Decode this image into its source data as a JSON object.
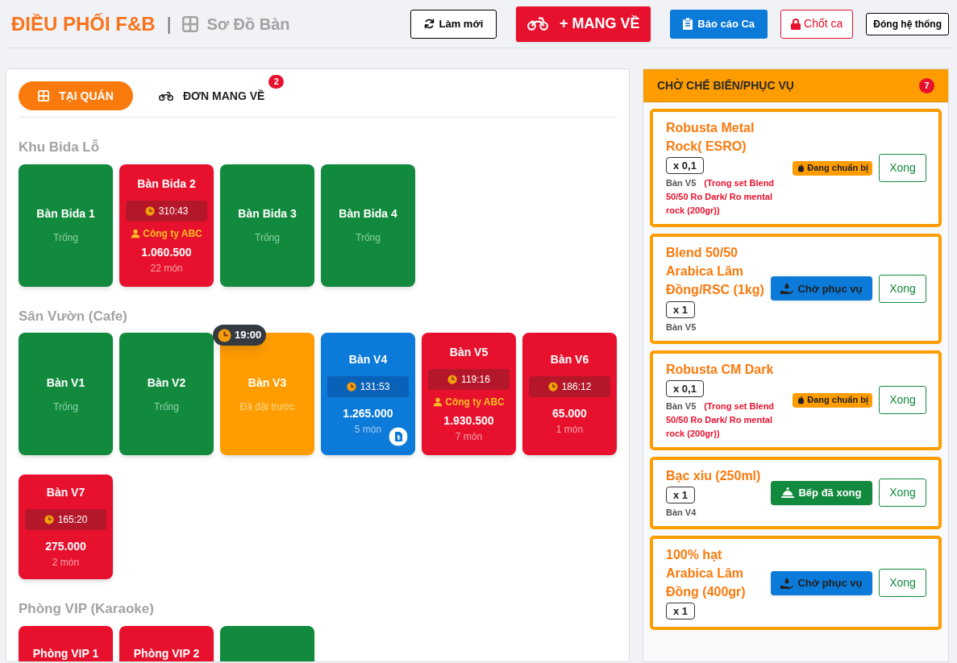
{
  "header": {
    "title": "ĐIỀU PHỐI F&B",
    "separator": "|",
    "subtitle": "Sơ Đồ Bàn",
    "buttons": [
      {
        "kind": "refresh",
        "label": "Làm mới"
      },
      {
        "kind": "takeaway",
        "label": "+ MANG VỀ"
      },
      {
        "kind": "report",
        "label": "Báo cáo Ca"
      },
      {
        "kind": "close_shift",
        "label": "Chốt ca"
      },
      {
        "kind": "shutdown",
        "label": "Đóng hệ thống"
      }
    ]
  },
  "tabs": [
    {
      "label": "TẠI QUÁN",
      "selected": true
    },
    {
      "label": "ĐƠN MANG VỀ",
      "selected": false,
      "badge": "2"
    }
  ],
  "areas": [
    {
      "title": "Khu Bida Lỗ",
      "tables": [
        {
          "name": "Bàn Bida 1",
          "kind": "empty",
          "status_text": "Trống"
        },
        {
          "name": "Bàn Bida 2",
          "kind": "occupied",
          "timer": "310:43",
          "customer": "Công ty ABC",
          "total": "1.060.500",
          "items": "22 món"
        },
        {
          "name": "Bàn Bida 3",
          "kind": "empty",
          "status_text": "Trống"
        },
        {
          "name": "Bàn Bida 4",
          "kind": "empty",
          "status_text": "Trống"
        }
      ]
    },
    {
      "title": "Sân Vườn (Cafe)",
      "tables": [
        {
          "name": "Bàn V1",
          "kind": "empty",
          "status_text": "Trống"
        },
        {
          "name": "Bàn V2",
          "kind": "empty",
          "status_text": "Trống"
        },
        {
          "name": "Bàn V3",
          "kind": "reserved",
          "status_text": "Đã đặt trước",
          "reservation_time": "19:00"
        },
        {
          "name": "Bàn V4",
          "kind": "billing",
          "timer": "131:53",
          "total": "1.265.000",
          "items": "5 món",
          "bill_icon": true
        },
        {
          "name": "Bàn V5",
          "kind": "occupied",
          "timer": "119:16",
          "customer": "Công ty ABC",
          "total": "1.930.500",
          "items": "7 món"
        },
        {
          "name": "Bàn V6",
          "kind": "occupied",
          "timer": "186:12",
          "total": "65.000",
          "items": "1 món"
        },
        {
          "name": "Bàn V7",
          "kind": "occupied",
          "timer": "165:20",
          "total": "275.000",
          "items": "2 món"
        }
      ]
    },
    {
      "title": "Phòng VIP (Karaoke)",
      "tables": [
        {
          "name": "Phòng VIP 1",
          "kind": "occupied"
        },
        {
          "name": "Phòng VIP 2",
          "kind": "occupied"
        },
        {
          "kind": "empty"
        }
      ]
    }
  ],
  "queue": {
    "title": "CHỜ CHẾ BIẾN/PHỤC VỤ",
    "count": "7",
    "items": [
      {
        "name": "Robusta Metal Rock( ESRO)",
        "qty": "x 0,1",
        "table": "Bàn V5",
        "note": "(Trong set Blend 50/50 Ro Dark/ Ro mental rock (200gr))",
        "kind": "preparing",
        "state_label": "Đang chuẩn bị",
        "done": "Xong"
      },
      {
        "name": "Blend 50/50 Arabica Lâm Đồng/RSC (1kg)",
        "qty": "x 1",
        "table": "Bàn V5",
        "kind": "waiting",
        "state_label": "Chờ phục vụ",
        "done": "Xong"
      },
      {
        "name": "Robusta CM Dark",
        "qty": "x 0,1",
        "table": "Bàn V5",
        "note": "(Trong set Blend 50/50 Ro Dark/ Ro mental rock (200gr))",
        "kind": "preparing",
        "state_label": "Đang chuẩn bị",
        "done": "Xong"
      },
      {
        "name": "Bạc xỉu (250ml)",
        "qty": "x 1",
        "table": "Bàn V4",
        "kind": "kitchen_done",
        "state_label": "Bếp đã xong",
        "done": "Xong"
      },
      {
        "name": "100% hạt Arabica Lâm Đồng (400gr)",
        "qty": "x 1",
        "kind": "waiting",
        "state_label": "Chờ phục vụ",
        "done": "Xong"
      }
    ]
  }
}
